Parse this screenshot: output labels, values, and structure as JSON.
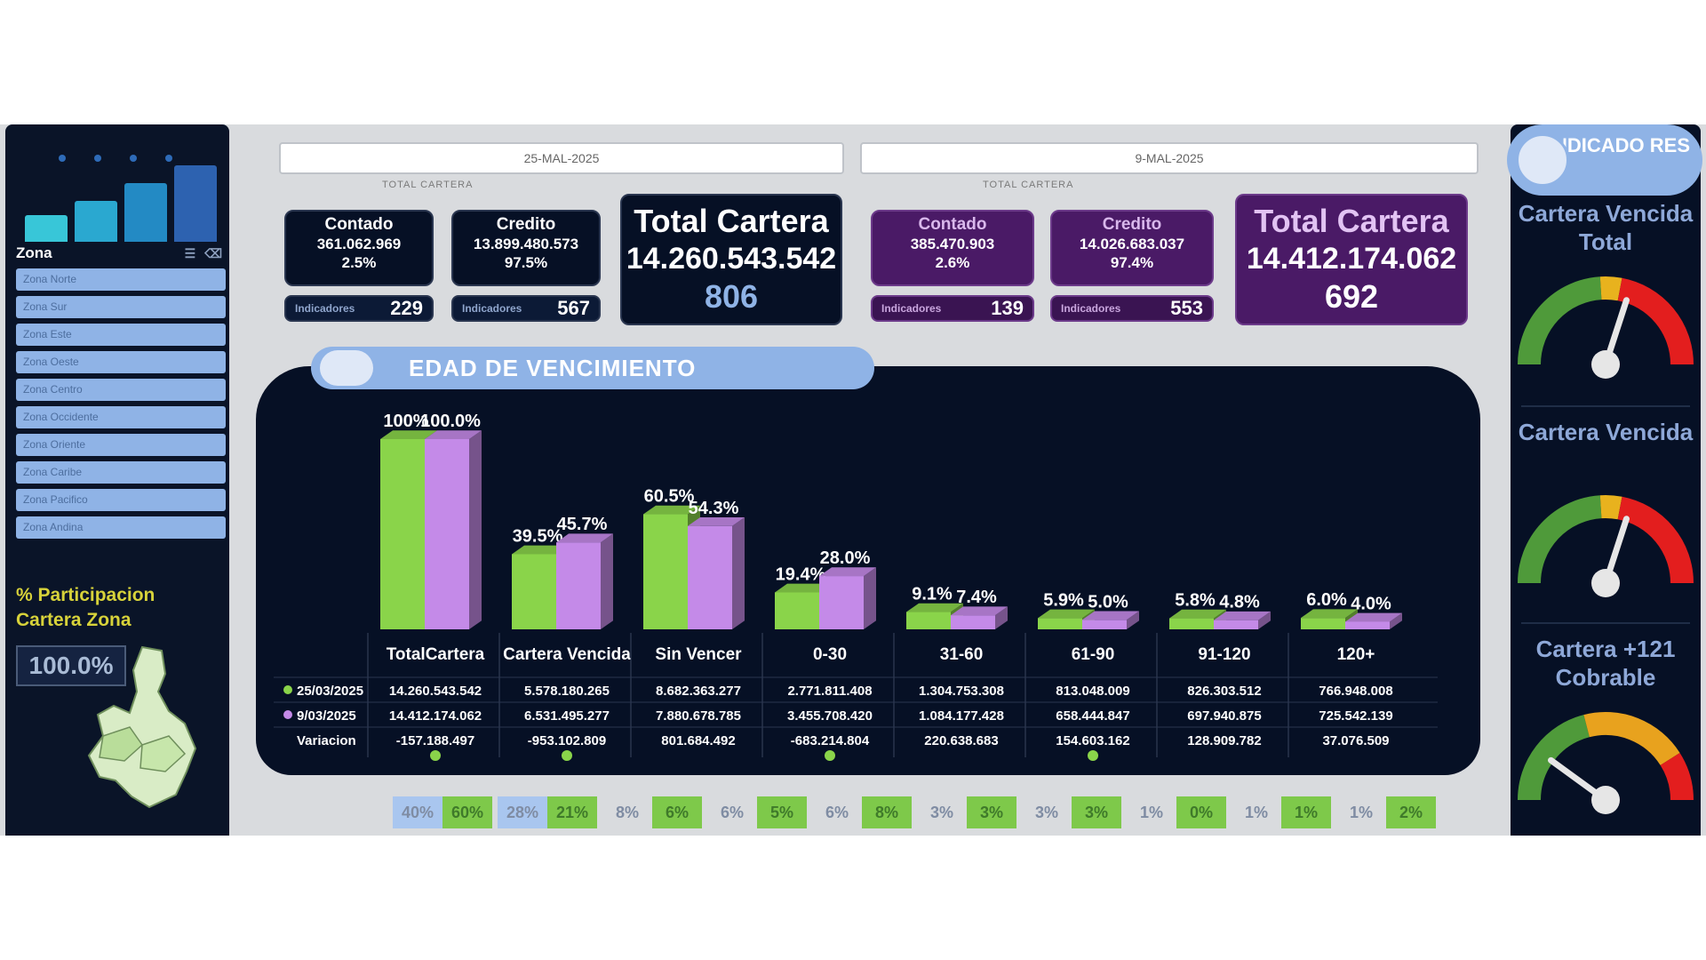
{
  "sidebar": {
    "brand_colors": [
      "#38c6d8",
      "#2aa8d0",
      "#238ac4",
      "#2d62b0"
    ],
    "zona_label": "Zona",
    "zona_tool_icons": [
      "filter-icon",
      "eraser-icon"
    ],
    "zona_items": [
      "Zona Norte",
      "Zona Sur",
      "Zona Este",
      "Zona Oeste",
      "Zona Centro",
      "Zona Occidente",
      "Zona Oriente",
      "Zona Caribe",
      "Zona Pacifico",
      "Zona Andina"
    ],
    "participacion_title": "% Participacion Cartera Zona",
    "participacion_value": "100.0%"
  },
  "filters": {
    "left_date": "25-MAL-2025",
    "right_date": "9-MAL-2025",
    "left_section_label": "TOTAL CARTERA",
    "right_section_label": "TOTAL CARTERA"
  },
  "left_kpis": {
    "contado": {
      "title": "Contado",
      "value": "361.062.969",
      "pct": "2.5%"
    },
    "credito": {
      "title": "Credito",
      "value": "13.899.480.573",
      "pct": "97.5%"
    },
    "ind_left": {
      "label": "Indicadores",
      "value": "229"
    },
    "ind_right": {
      "label": "Indicadores",
      "value": "567"
    },
    "total": {
      "title": "Total Cartera",
      "value": "14.260.543.542",
      "count": "806"
    }
  },
  "right_kpis": {
    "contado": {
      "title": "Contado",
      "value": "385.470.903",
      "pct": "2.6%"
    },
    "credito": {
      "title": "Credito",
      "value": "14.026.683.037",
      "pct": "97.4%"
    },
    "ind_left": {
      "label": "Indicadores",
      "value": "139"
    },
    "ind_right": {
      "label": "Indicadores",
      "value": "553"
    },
    "total": {
      "title": "Total Cartera",
      "value": "14.412.174.062",
      "count": "692"
    }
  },
  "chart_title": "EDAD DE VENCIMIENTO",
  "chart_data": {
    "type": "bar",
    "categories": [
      "TotalCartera",
      "Cartera Vencida",
      "Sin Vencer",
      "0-30",
      "31-60",
      "61-90",
      "91-120",
      "120+"
    ],
    "series": [
      {
        "values": [
          100.0,
          39.5,
          60.5,
          19.4,
          9.1,
          5.9,
          5.8,
          6.0
        ],
        "labels": [
          "100%",
          "39.5%",
          "60.5%",
          "19.4%",
          "9.1%",
          "5.9%",
          "5.8%",
          "6.0%"
        ],
        "color": "#8ad44a"
      },
      {
        "values": [
          100.0,
          45.7,
          54.3,
          28.0,
          7.4,
          5.0,
          4.8,
          4.0
        ],
        "labels": [
          "100.0%",
          "45.7%",
          "54.3%",
          "28.0%",
          "7.4%",
          "5.0%",
          "4.8%",
          "4.0%"
        ],
        "color": "#c48ae8"
      }
    ],
    "ylim": [
      0,
      100
    ],
    "table_rows": [
      {
        "label": "25/03/2025",
        "dot_color": "#8ad44a",
        "values": [
          "14.260.543.542",
          "5.578.180.265",
          "8.682.363.277",
          "2.771.811.408",
          "1.304.753.308",
          "813.048.009",
          "826.303.512",
          "766.948.008"
        ]
      },
      {
        "label": "9/03/2025",
        "dot_color": "#c48ae8",
        "values": [
          "14.412.174.062",
          "6.531.495.277",
          "7.880.678.785",
          "3.455.708.420",
          "1.084.177.428",
          "658.444.847",
          "697.940.875",
          "725.542.139"
        ]
      },
      {
        "label": "Variacion",
        "dot_color": "",
        "values": [
          "-157.188.497",
          "-953.102.809",
          "801.684.492",
          "-683.214.804",
          "220.638.683",
          "154.603.162",
          "128.909.782",
          "37.076.509"
        ]
      }
    ]
  },
  "bottom_strip": [
    {
      "a": "40%",
      "b": "60%"
    },
    {
      "a": "28%",
      "b": "21%"
    },
    {
      "a": "8%",
      "b": "6%"
    },
    {
      "a": "6%",
      "b": "5%"
    },
    {
      "a": "6%",
      "b": "8%"
    },
    {
      "a": "3%",
      "b": "3%"
    },
    {
      "a": "3%",
      "b": "3%"
    },
    {
      "a": "1%",
      "b": "0%"
    },
    {
      "a": "1%",
      "b": "1%"
    },
    {
      "a": "1%",
      "b": "2%"
    }
  ],
  "right_panel": {
    "header": "INDICADO RES",
    "gauges": [
      {
        "title": "Cartera Vencida Total",
        "level": 0.6
      },
      {
        "title": "Cartera Vencida",
        "level": 0.6
      },
      {
        "title": "Cartera +121 Cobrable",
        "level": 0.2
      }
    ]
  }
}
